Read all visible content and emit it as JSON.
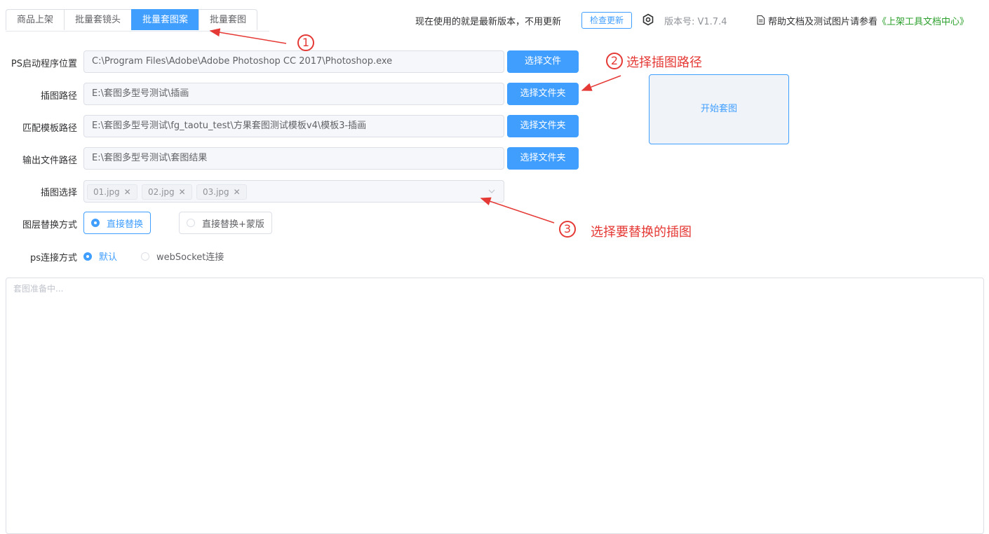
{
  "tabs": [
    {
      "label": "商品上架",
      "active": false
    },
    {
      "label": "批量套镜头",
      "active": false
    },
    {
      "label": "批量套图案",
      "active": true
    },
    {
      "label": "批量套图",
      "active": false
    }
  ],
  "header": {
    "update_status": "现在使用的就是最新版本，不用更新",
    "check_update_button": "检查更新",
    "version": "版本号: V1.7.4",
    "help_prefix": "帮助文档及测试图片请参看",
    "help_link": "《上架工具文档中心》",
    "gear_icon": "gear-icon",
    "doc_icon": "document-icon"
  },
  "form": {
    "ps_path": {
      "label": "PS启动程序位置",
      "value": "C:\\Program Files\\Adobe\\Adobe Photoshop CC 2017\\Photoshop.exe",
      "button": "选择文件"
    },
    "illus_path": {
      "label": "插图路径",
      "value": "E:\\套图多型号测试\\插画",
      "button": "选择文件夹"
    },
    "template_path": {
      "label": "匹配模板路径",
      "value": "E:\\套图多型号测试\\fg_taotu_test\\方果套图测试模板v4\\模板3-插画",
      "button": "选择文件夹"
    },
    "output_path": {
      "label": "输出文件路径",
      "value": "E:\\套图多型号测试\\套图结果",
      "button": "选择文件夹"
    },
    "illus_select": {
      "label": "插图选择",
      "tags": [
        "01.jpg",
        "02.jpg",
        "03.jpg"
      ]
    },
    "layer_mode": {
      "label": "图层替换方式",
      "options": [
        "直接替换",
        "直接替换+蒙版"
      ],
      "selected": 0
    },
    "ps_connect": {
      "label": "ps连接方式",
      "options": [
        "默认",
        "webSocket连接"
      ],
      "selected": 0
    }
  },
  "start_button": "开始套图",
  "log": {
    "placeholder": "套图准备中..."
  },
  "annotations": {
    "n1": "1",
    "n2": "2",
    "n3": "3",
    "a2": "选择插图路径",
    "a3": "选择要替换的插图"
  },
  "colors": {
    "accent": "#409eff",
    "annotation": "#e53935",
    "link": "#2ca02c"
  }
}
